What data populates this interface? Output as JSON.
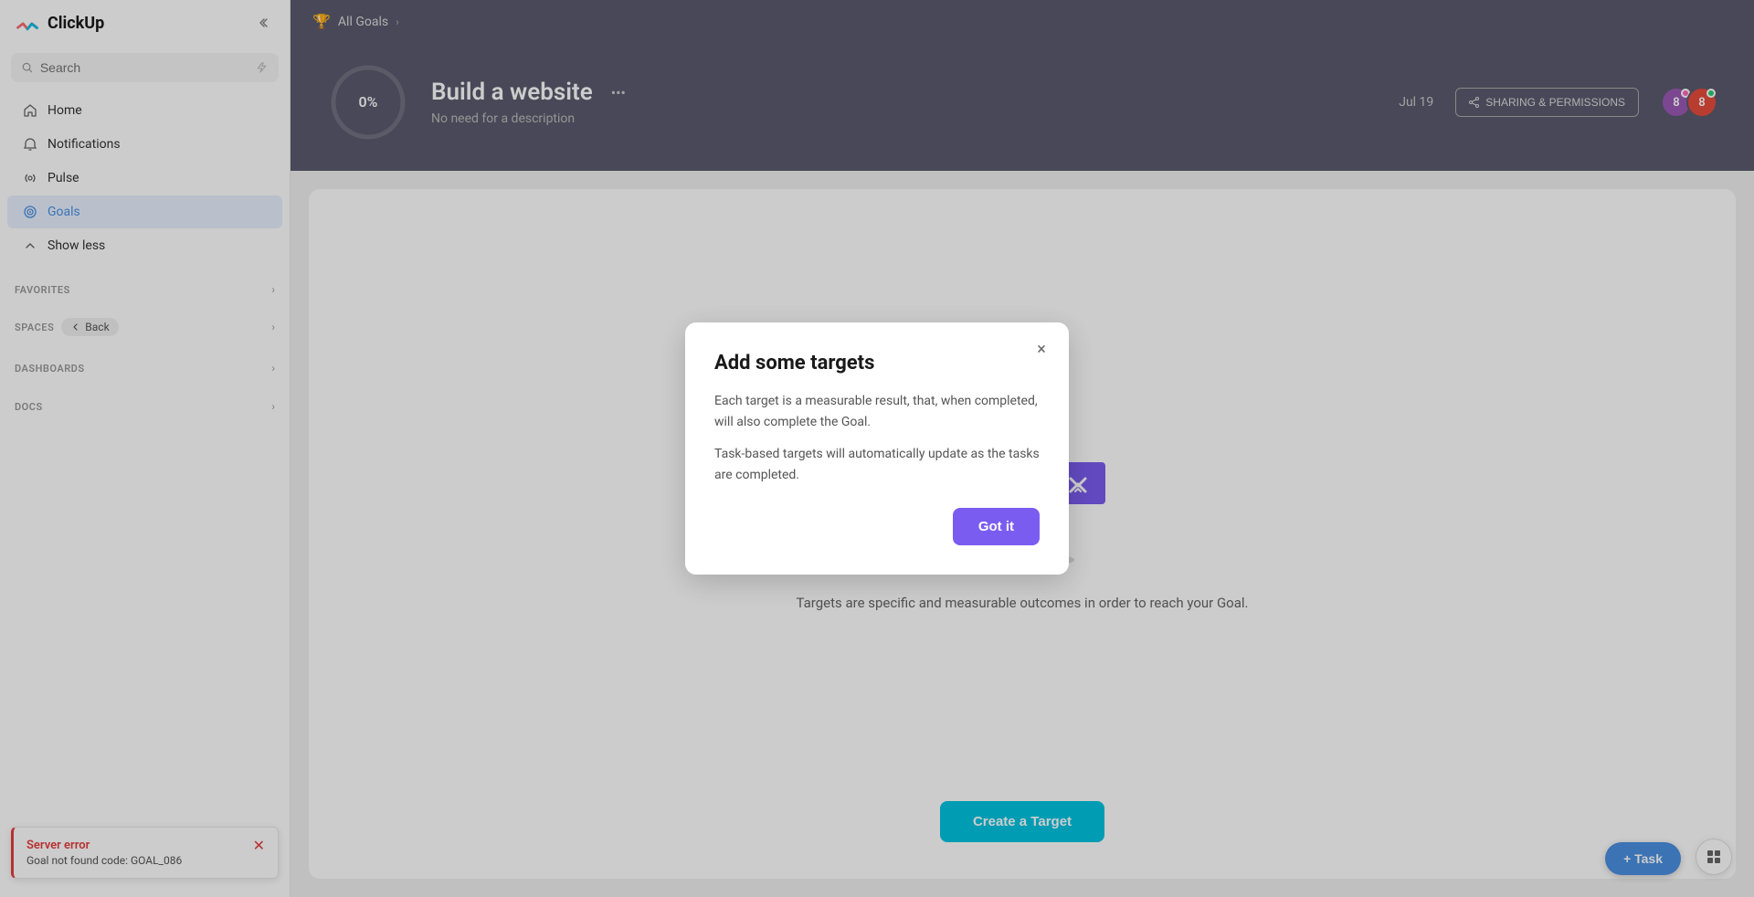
{
  "app": {
    "name": "ClickUp"
  },
  "sidebar": {
    "collapse_label": "Collapse sidebar",
    "search_placeholder": "Search",
    "lightning_icon": "⚡",
    "nav_items": [
      {
        "id": "home",
        "label": "Home",
        "icon": "home"
      },
      {
        "id": "notifications",
        "label": "Notifications",
        "icon": "bell"
      },
      {
        "id": "pulse",
        "label": "Pulse",
        "icon": "radio"
      },
      {
        "id": "goals",
        "label": "Goals",
        "icon": "target",
        "active": true
      },
      {
        "id": "show-less",
        "label": "Show less",
        "icon": "chevron-up"
      }
    ],
    "sections": [
      {
        "id": "favorites",
        "label": "FAVORITES"
      },
      {
        "id": "spaces",
        "label": "SPACES",
        "back_label": "Back"
      },
      {
        "id": "dashboards",
        "label": "DASHBOARDS"
      },
      {
        "id": "docs",
        "label": "DOCS"
      }
    ],
    "error": {
      "title": "Server error",
      "description": "Goal not found code: GOAL_086"
    }
  },
  "breadcrumb": {
    "icon": "trophy",
    "text": "All Goals",
    "arrow": "›"
  },
  "goal": {
    "progress_percent": "0%",
    "title": "Build a website",
    "description": "No need for a description",
    "date": "Jul 19",
    "sharing_label": "SHARING & PERMISSIONS",
    "avatars": [
      {
        "initials": "8",
        "color": "#9b59b6"
      },
      {
        "initials": "8",
        "color": "#e74c3c"
      }
    ]
  },
  "modal": {
    "title": "Add some targets",
    "body_1": "Each target is a measurable result, that, when completed, will also complete the Goal.",
    "body_2": "Task-based targets will automatically update as the tasks are completed.",
    "got_it_label": "Got it",
    "close_icon": "×"
  },
  "content": {
    "targets_text": "Targets are specific and measurable outcomes in order to reach your Goal.",
    "create_btn_label": "Create a Target"
  },
  "fab": {
    "task_label": "+ Task"
  }
}
